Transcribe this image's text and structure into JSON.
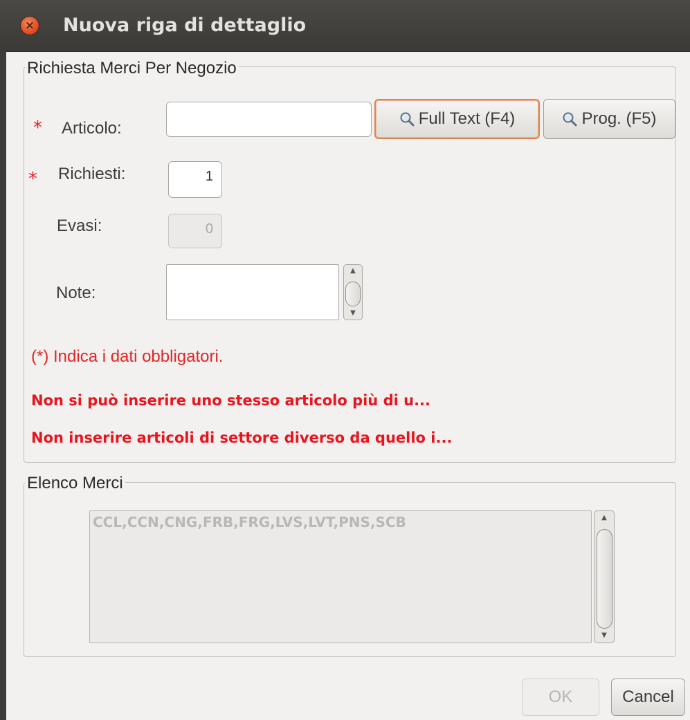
{
  "window": {
    "title": "Nuova riga di dettaglio",
    "close_glyph": "×"
  },
  "group_request": {
    "legend": "Richiesta Merci Per Negozio",
    "required_marker": "*",
    "articolo": {
      "label": "Articolo:",
      "value": "",
      "placeholder": ""
    },
    "btn_fulltext": "Full Text (F4)",
    "btn_prog": "Prog. (F5)",
    "richiesti": {
      "label": "Richiesti:",
      "value": "1"
    },
    "evasi": {
      "label": "Evasi:",
      "value": "0"
    },
    "note": {
      "label": "Note:",
      "value": ""
    },
    "required_hint": "(*) Indica i dati obbligatori.",
    "warning_1": "Non si può inserire uno stesso articolo più di u...",
    "warning_2": "Non inserire articoli di settore diverso da quello i..."
  },
  "group_goods": {
    "legend": "Elenco Merci",
    "list_text": "CCL,CCN,CNG,FRB,FRG,LVS,LVT,PNS,SCB"
  },
  "footer": {
    "ok_label": "OK",
    "cancel_label": "Cancel"
  },
  "icons": {
    "close": "close-icon",
    "search": "magnifier-icon",
    "scroll_up": "scroll-up-icon",
    "scroll_down": "scroll-down-icon"
  },
  "colors": {
    "required": "#e52424",
    "focus_ring": "#e0824f",
    "titlebar": "#3c3b38"
  }
}
